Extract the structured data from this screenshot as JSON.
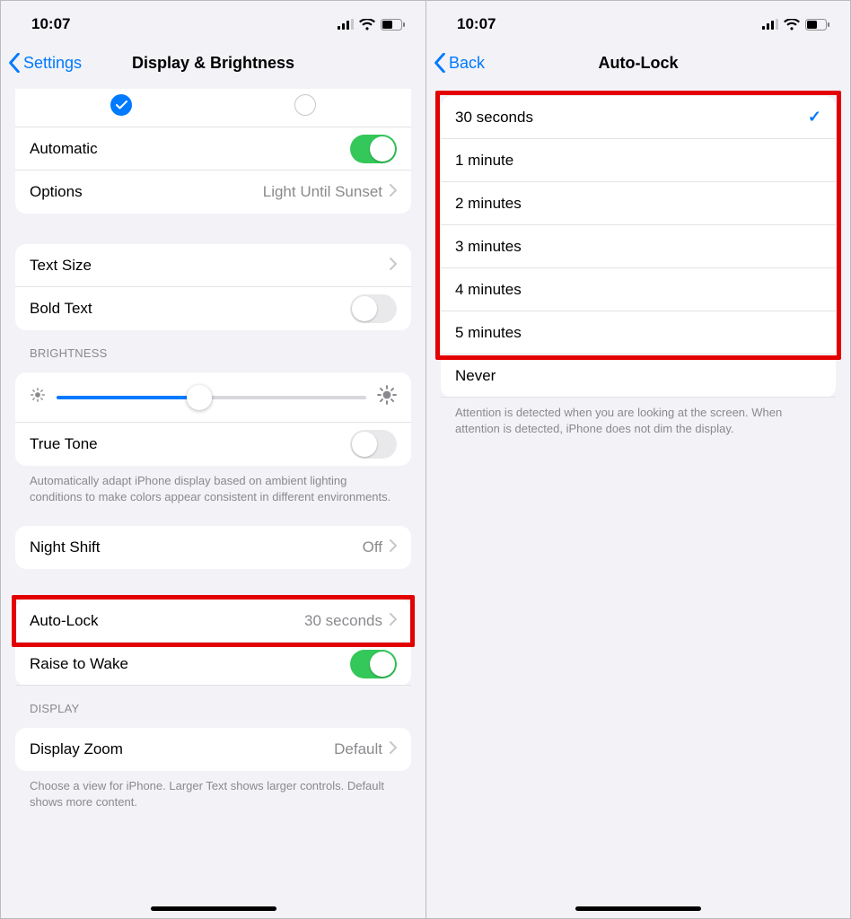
{
  "status": {
    "time": "10:07"
  },
  "left": {
    "back_label": "Settings",
    "title": "Display & Brightness",
    "automatic_label": "Automatic",
    "options_label": "Options",
    "options_value": "Light Until Sunset",
    "text_size_label": "Text Size",
    "bold_text_label": "Bold Text",
    "brightness_header": "BRIGHTNESS",
    "true_tone_label": "True Tone",
    "true_tone_footer": "Automatically adapt iPhone display based on ambient lighting conditions to make colors appear consistent in different environments.",
    "night_shift_label": "Night Shift",
    "night_shift_value": "Off",
    "auto_lock_label": "Auto-Lock",
    "auto_lock_value": "30 seconds",
    "raise_to_wake_label": "Raise to Wake",
    "display_header": "DISPLAY",
    "display_zoom_label": "Display Zoom",
    "display_zoom_value": "Default",
    "display_zoom_footer": "Choose a view for iPhone. Larger Text shows larger controls. Default shows more content.",
    "brightness_percent": 46
  },
  "right": {
    "back_label": "Back",
    "title": "Auto-Lock",
    "options": [
      {
        "label": "30 seconds",
        "selected": true
      },
      {
        "label": "1 minute",
        "selected": false
      },
      {
        "label": "2 minutes",
        "selected": false
      },
      {
        "label": "3 minutes",
        "selected": false
      },
      {
        "label": "4 minutes",
        "selected": false
      },
      {
        "label": "5 minutes",
        "selected": false
      },
      {
        "label": "Never",
        "selected": false
      }
    ],
    "footer": "Attention is detected when you are looking at the screen. When attention is detected, iPhone does not dim the display."
  }
}
